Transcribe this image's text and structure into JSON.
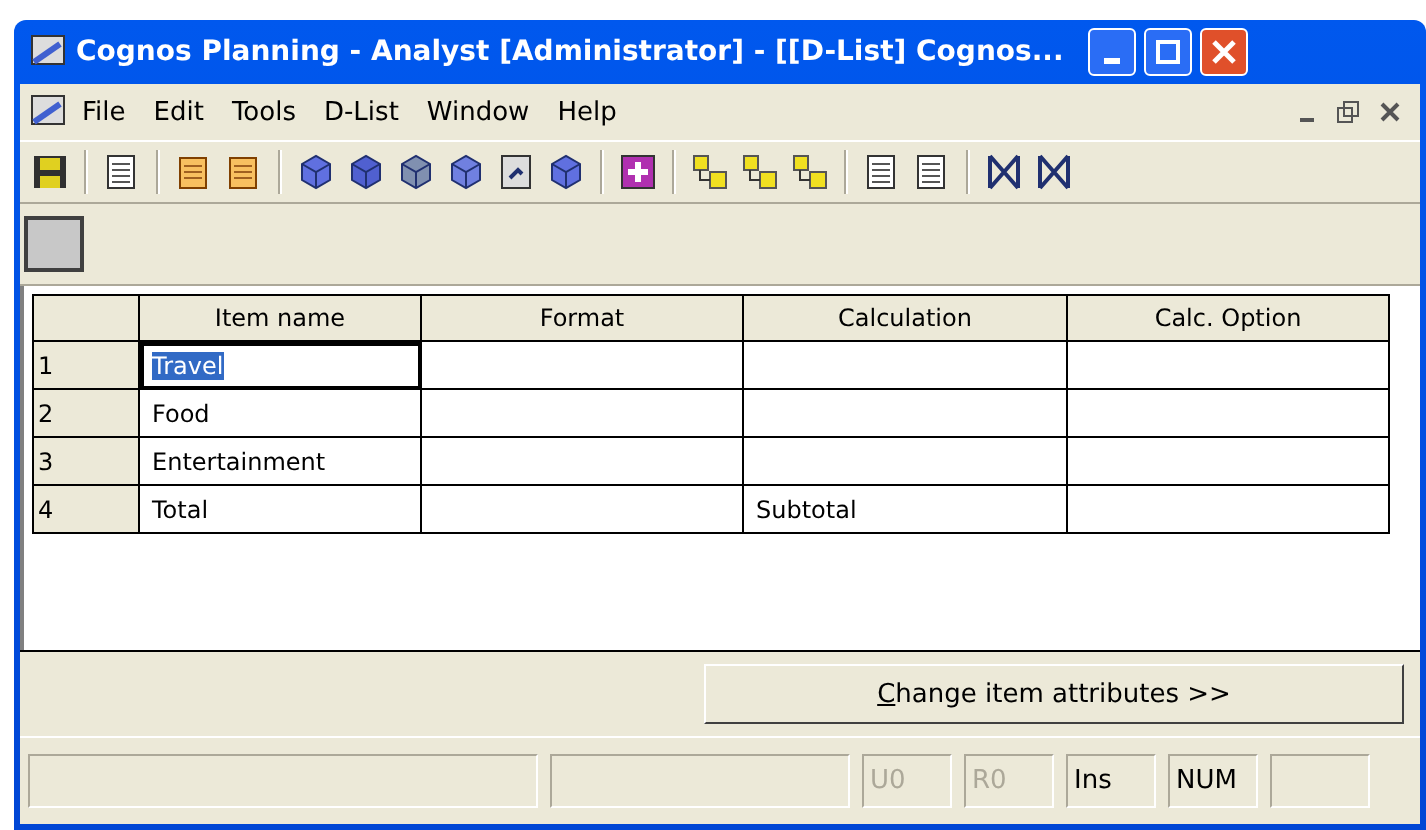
{
  "window": {
    "title": "Cognos Planning - Analyst [Administrator] - [[D-List] Cognos..."
  },
  "menu": [
    {
      "label": "File"
    },
    {
      "label": "Edit"
    },
    {
      "label": "Tools"
    },
    {
      "label": "D-List"
    },
    {
      "label": "Window"
    },
    {
      "label": "Help"
    }
  ],
  "table": {
    "columns": [
      "Item name",
      "Format",
      "Calculation",
      "Calc. Option"
    ],
    "rows": [
      {
        "number": "1",
        "selected": true,
        "cells": [
          "Travel",
          "",
          "",
          ""
        ]
      },
      {
        "number": "2",
        "selected": false,
        "cells": [
          "Food",
          "",
          "",
          ""
        ]
      },
      {
        "number": "3",
        "selected": false,
        "cells": [
          "Entertainment",
          "",
          "",
          ""
        ]
      },
      {
        "number": "4",
        "selected": false,
        "cells": [
          "Total",
          "",
          "Subtotal",
          ""
        ]
      }
    ]
  },
  "action_button": {
    "label": "Change item attributes >>"
  },
  "status_bar": [
    {
      "kind": "blank"
    },
    {
      "kind": "blank"
    },
    {
      "kind": "text",
      "text": "U0",
      "disabled": true
    },
    {
      "kind": "text",
      "text": "R0",
      "disabled": true
    },
    {
      "kind": "text",
      "text": "Ins",
      "disabled": false
    },
    {
      "kind": "text",
      "text": "NUM",
      "disabled": false
    },
    {
      "kind": "blank"
    }
  ]
}
